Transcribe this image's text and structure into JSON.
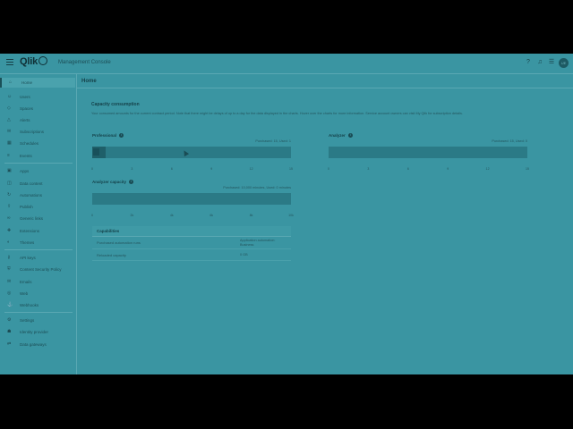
{
  "header": {
    "logo": "Qlik",
    "app_title": "Management Console",
    "icons": [
      "help-icon",
      "notification-icon",
      "apps-grid-icon"
    ],
    "avatar_initials": "UE"
  },
  "sidebar": {
    "items": [
      {
        "label": "Home",
        "icon": "home-icon",
        "active": true
      },
      {
        "label": "Users",
        "icon": "user-icon"
      },
      {
        "label": "Spaces",
        "icon": "spaces-icon"
      },
      {
        "label": "Alerts",
        "icon": "alert-icon"
      },
      {
        "label": "Subscriptions",
        "icon": "mail-icon"
      },
      {
        "label": "Schedules",
        "icon": "calendar-icon"
      },
      {
        "label": "Events",
        "icon": "events-icon"
      },
      {
        "label": "Apps",
        "icon": "apps-icon"
      },
      {
        "label": "Data content",
        "icon": "data-icon"
      },
      {
        "label": "Automations",
        "icon": "automation-icon"
      },
      {
        "label": "Publish",
        "icon": "publish-icon"
      },
      {
        "label": "Generic links",
        "icon": "link-icon"
      },
      {
        "label": "Extensions",
        "icon": "extension-icon"
      },
      {
        "label": "Themes",
        "icon": "theme-icon"
      },
      {
        "label": "API keys",
        "icon": "key-icon"
      },
      {
        "label": "Content Security Policy",
        "icon": "shield-icon"
      },
      {
        "label": "Emails",
        "icon": "email-icon"
      },
      {
        "label": "Web",
        "icon": "web-icon"
      },
      {
        "label": "Webhooks",
        "icon": "webhook-icon"
      },
      {
        "label": "Settings",
        "icon": "gear-icon"
      },
      {
        "label": "Identity provider",
        "icon": "identity-icon"
      },
      {
        "label": "Data gateways",
        "icon": "gateway-icon"
      }
    ]
  },
  "main": {
    "page_title": "Home",
    "section_title": "Capacity consumption",
    "section_desc": "Your consumed amounts for the current contract period. Note that there might be delays of up to a day for the data displayed in the charts. Hover over the charts for more information. Service account owners can visit My Qlik for subscription details.",
    "professional": {
      "title": "Professional",
      "purchased": "Purchased: 15, Used: 1",
      "fraction": 0.067,
      "ticks": [
        "0",
        "3",
        "6",
        "9",
        "12",
        "15"
      ]
    },
    "analyzer": {
      "title": "Analyzer",
      "purchased": "Purchased: 15, Used: 0",
      "fraction": 0,
      "ticks": [
        "0",
        "3",
        "6",
        "9",
        "12",
        "15"
      ]
    },
    "analyzer_capacity": {
      "title": "Analyzer capacity",
      "purchased": "Purchased: 10,000 minutes, Used: 0 minutes",
      "fraction": 0,
      "ticks": [
        "0",
        "2k",
        "4k",
        "6k",
        "8k",
        "10k"
      ]
    },
    "capabilities": {
      "header": "Capabilities",
      "rows": [
        {
          "key": "Purchased automation runs",
          "value": "Application automation: Business"
        },
        {
          "key": "Reloaded capacity",
          "value": "0 GB"
        }
      ]
    }
  }
}
